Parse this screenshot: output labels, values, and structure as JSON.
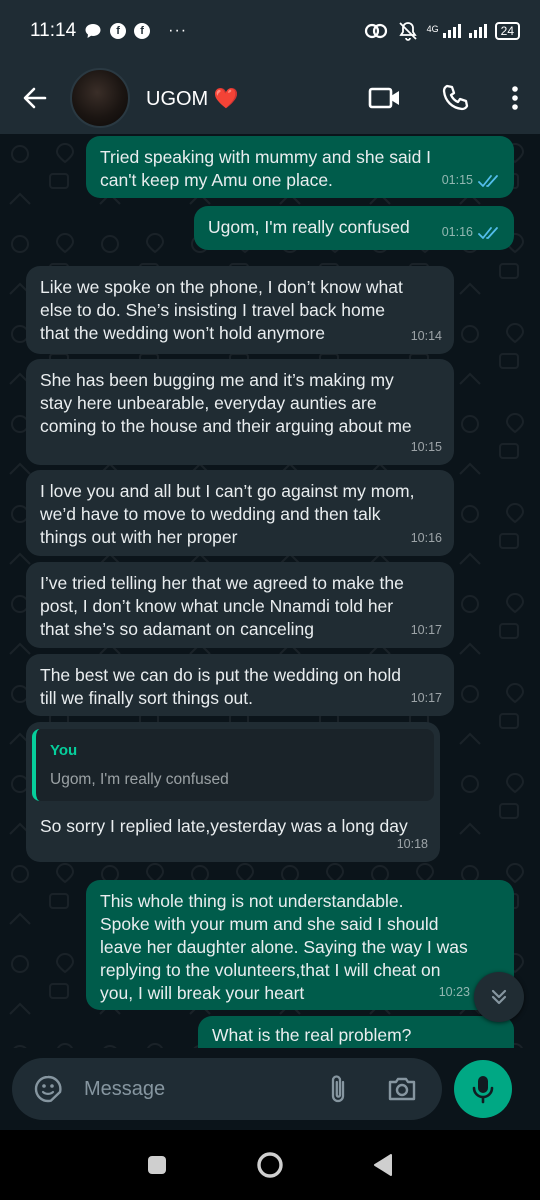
{
  "status_bar": {
    "time": "11:14",
    "left_icons": [
      "chat-bubble-icon",
      "facebook-icon",
      "facebook-icon"
    ],
    "more": "···",
    "network": "4G",
    "battery": "24"
  },
  "header": {
    "contact_name": "UGOM ❤️",
    "icons": [
      "back-arrow-icon",
      "video-call-icon",
      "phone-icon",
      "more-vert-icon"
    ]
  },
  "messages": [
    {
      "direction": "out",
      "text": "Tried speaking with mummy and she said I\ncan't keep my Amu one place.",
      "time": "01:15",
      "read": true
    },
    {
      "direction": "out",
      "text": "Ugom, I'm really confused",
      "time": "01:16",
      "read": true
    },
    {
      "direction": "in",
      "text": "Like we spoke on the phone, I don’t know what\nelse to do. She’s insisting I travel back home\nthat the wedding won’t hold anymore",
      "time": "10:14"
    },
    {
      "direction": "in",
      "text": "She has been bugging me and it’s making my\nstay here unbearable, everyday aunties are\ncoming to the house and their arguing about me",
      "time": "10:15"
    },
    {
      "direction": "in",
      "text": "I love you and all but I can’t go against my mom,\nwe’d have to move to wedding and then talk\nthings out with her proper",
      "time": "10:16"
    },
    {
      "direction": "in",
      "text": "I’ve tried telling her that we agreed to make the\npost, I don’t know what uncle Nnamdi told her\nthat she’s so adamant on canceling",
      "time": "10:17"
    },
    {
      "direction": "in",
      "text": "The best we can do is put the wedding on hold\ntill we finally sort things out.",
      "time": "10:17"
    },
    {
      "direction": "in",
      "quote_author": "You",
      "quote_text": "Ugom, I'm really confused",
      "text": "So sorry I replied late,yesterday was a long day",
      "time": "10:18"
    },
    {
      "direction": "out",
      "text": "This whole thing is not understandable.\nSpoke with your mum and she said I should\nleave her daughter alone. Saying the way I was\nreplying to the volunteers,that I will cheat on\nyou, I will break your heart",
      "time": "10:23"
    },
    {
      "direction": "out",
      "text": "What is the real problem?",
      "time": ""
    }
  ],
  "composer": {
    "placeholder": "Message",
    "icons": [
      "sticker-icon",
      "attach-icon",
      "camera-icon",
      "mic-icon"
    ]
  },
  "colors": {
    "outgoing_bubble": "#005c4b",
    "incoming_bubble": "#202c33",
    "chat_background": "#0b141a",
    "header": "#1f2c34",
    "accent": "#00a884",
    "read_tick": "#53bdeb"
  }
}
